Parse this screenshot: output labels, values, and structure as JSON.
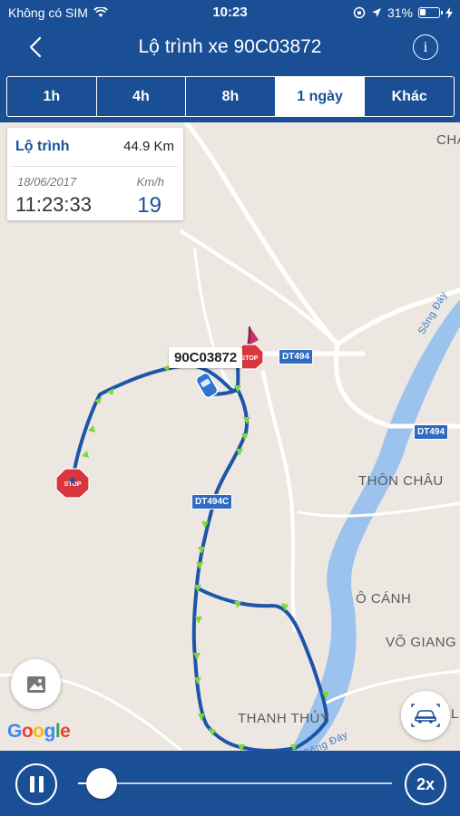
{
  "status_bar": {
    "carrier": "Không có SIM",
    "time": "10:23",
    "battery": "31%",
    "battery_level": 0.31
  },
  "nav": {
    "title": "Lộ trình xe 90C03872",
    "back_icon": "chevron-left-icon",
    "info_icon": "info-icon"
  },
  "time_tabs": [
    {
      "label": "1h",
      "active": false
    },
    {
      "label": "4h",
      "active": false
    },
    {
      "label": "8h",
      "active": false
    },
    {
      "label": "1 ngày",
      "active": true
    },
    {
      "label": "Khác",
      "active": false
    }
  ],
  "info_card": {
    "route_label": "Lộ trình",
    "route_value": "44.9 Km",
    "date": "18/06/2017",
    "speed_unit": "Km/h",
    "time": "11:23:33",
    "speed": "19"
  },
  "map": {
    "vehicle_tag": "90C03872",
    "places": [
      "CHA",
      "THÔN CHÂU",
      "Ô CÁNH",
      "VÕ GIANG",
      "THANH THỦY",
      "L"
    ],
    "roads": [
      "DT494",
      "DT494",
      "DT494C"
    ],
    "rivers": [
      "Sông Đáy",
      "Sông Đáy"
    ],
    "stop_sign_text": "STOP",
    "google_logo": "Google",
    "colors": {
      "route": "#1d55a8",
      "arrows": "#7fd63a",
      "river": "#9cc3ee",
      "stop": "#d9363e"
    }
  },
  "player": {
    "progress": 0.04,
    "speed_label": "2x"
  }
}
